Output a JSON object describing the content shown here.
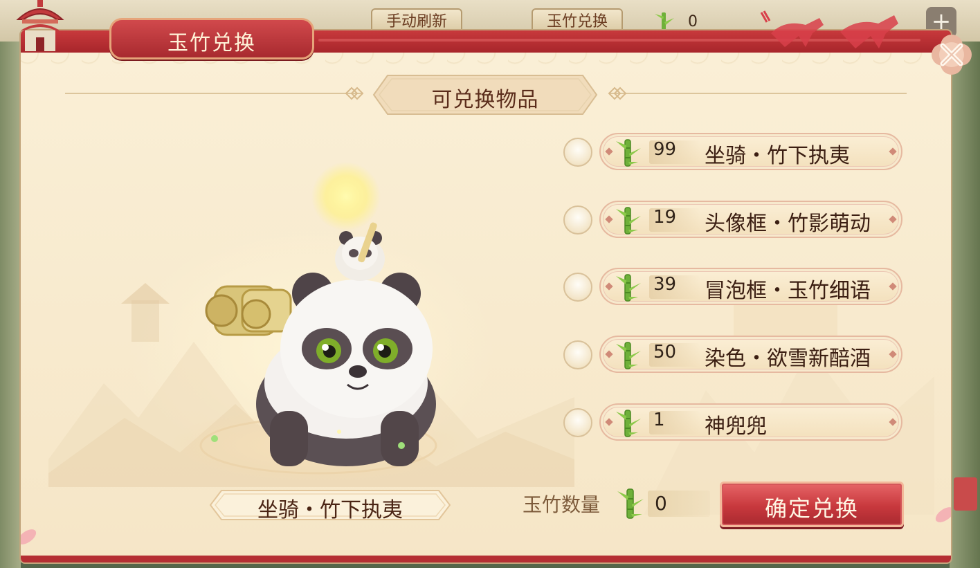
{
  "background": {
    "tabs": [
      "手动刷新",
      "玉竹兑换"
    ],
    "jade_amount": "0",
    "plus_label": "+"
  },
  "dialog": {
    "title": "玉竹兑换",
    "section_title": "可兑换物品",
    "preview_item_name": "坐骑・竹下执夷",
    "options": [
      {
        "cost": "99",
        "name": "坐骑・竹下执夷"
      },
      {
        "cost": "19",
        "name": "头像框・竹影萌动"
      },
      {
        "cost": "39",
        "name": "冒泡框・玉竹细语"
      },
      {
        "cost": "50",
        "name": "染色・欲雪新醅酒"
      },
      {
        "cost": "1",
        "name": "神兜兜"
      }
    ],
    "jade_count_label": "玉竹数量",
    "jade_count_value": "0",
    "confirm_label": "确定兑换",
    "close_icon": "close-icon"
  },
  "colors": {
    "title_red": "#b52f33",
    "panel_bg": "#f7e9cd",
    "text_brown": "#3b1e12",
    "bamboo_green": "#6fb03a"
  }
}
